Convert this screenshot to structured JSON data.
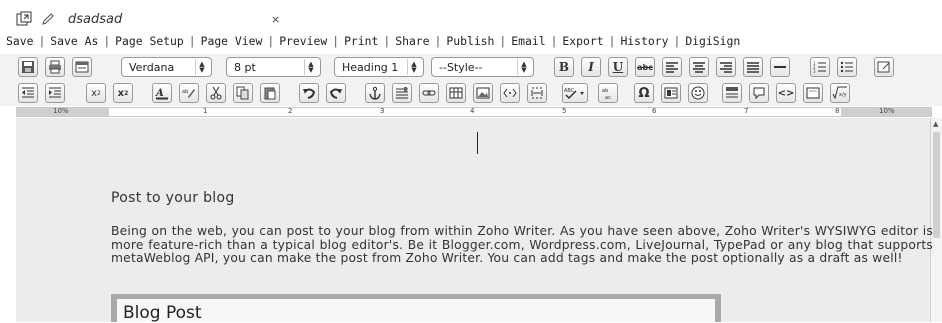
{
  "tab": {
    "title": "dsadsad",
    "close": "×"
  },
  "menu": [
    "Save",
    "Save As",
    "Page Setup",
    "Page View",
    "Preview",
    "Print",
    "Share",
    "Publish",
    "Email",
    "Export",
    "History",
    "DigiSign"
  ],
  "menu_separator": "|",
  "toolbar": {
    "font_family": "Verdana",
    "font_size": "8 pt",
    "heading": "Heading 1",
    "style": "--Style--",
    "bold": "B",
    "italic": "I",
    "underline": "U",
    "strike": "abc",
    "subscript": "x",
    "superscript": "x",
    "omega": "Ω",
    "html_tag": "<>"
  },
  "ruler": {
    "labels": [
      "10%",
      "1",
      "2",
      "3",
      "4",
      "5",
      "6",
      "7",
      "8",
      "10%"
    ]
  },
  "document": {
    "heading": "Post to your blog",
    "paragraph": "Being on the web, you can post to your blog from within Zoho Writer. As you have seen above, Zoho Writer's WYSIWYG editor is more feature-rich than a typical blog editor's. Be it Blogger.com, Wordpress.com, LiveJournal, TypePad or any blog that supports metaWeblog API, you can make the post from Zoho Writer. You can add tags and make the post optionally as a draft as well!",
    "box_title": "Blog Post"
  },
  "colors": {
    "toolbar_bg": "#f2f2f2",
    "doc_bg": "#ececec",
    "box_border": "#a9a9a9"
  }
}
